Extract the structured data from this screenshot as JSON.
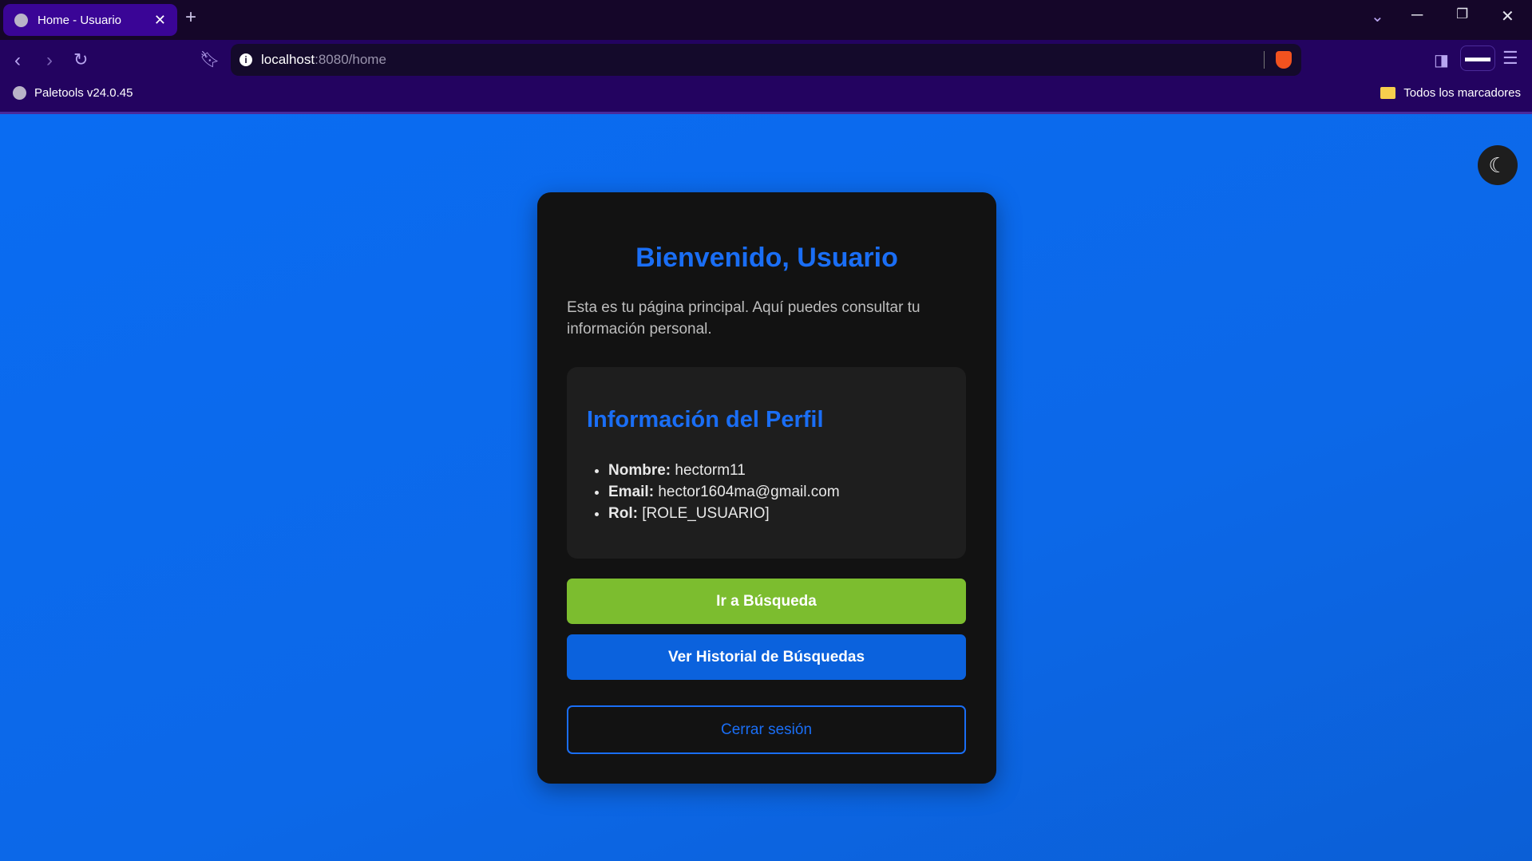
{
  "browser": {
    "tab_title": "Home - Usuario",
    "url_host": "localhost",
    "url_path": ":8080/home",
    "bookmark": "Paletools v24.0.45",
    "all_bookmarks": "Todos los marcadores"
  },
  "main": {
    "title": "Bienvenido, Usuario",
    "intro": "Esta es tu página principal. Aquí puedes consultar tu información personal.",
    "profile": {
      "title": "Información del Perfil",
      "items": [
        {
          "label": "Nombre:",
          "value": "hectorm11"
        },
        {
          "label": "Email:",
          "value": "hector1604ma@gmail.com"
        },
        {
          "label": "Rol:",
          "value": "[ROLE_USUARIO]"
        }
      ]
    },
    "buttons": {
      "search": "Ir a Búsqueda",
      "history": "Ver Historial de Búsquedas",
      "logout": "Cerrar sesión"
    }
  },
  "colors": {
    "accent": "#1a6ef5",
    "green": "#7cbd2f",
    "card": "#121212"
  }
}
